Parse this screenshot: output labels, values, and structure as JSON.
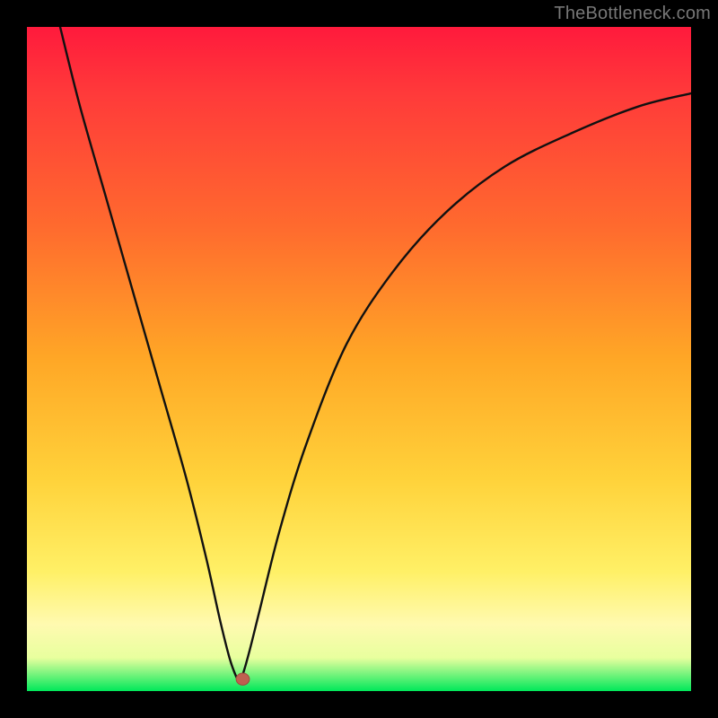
{
  "watermark": "TheBottleneck.com",
  "colors": {
    "curve_stroke": "#111111",
    "marker_fill": "#c06050",
    "marker_stroke": "#a04a3e"
  },
  "chart_data": {
    "type": "line",
    "title": "",
    "xlabel": "",
    "ylabel": "",
    "xlim": [
      0,
      100
    ],
    "ylim": [
      0,
      100
    ],
    "grid": false,
    "series": [
      {
        "name": "bottleneck-curve",
        "x": [
          5,
          8,
          12,
          16,
          20,
          24,
          27,
          29,
          30.5,
          31.5,
          32,
          32.5,
          33.5,
          35,
          38,
          42,
          48,
          55,
          63,
          72,
          82,
          92,
          100
        ],
        "y": [
          100,
          88,
          74,
          60,
          46,
          32,
          20,
          11,
          5,
          2.2,
          1.6,
          2.5,
          6,
          12,
          24,
          37,
          52,
          63,
          72,
          79,
          84,
          88,
          90
        ]
      }
    ],
    "marker": {
      "x": 32.5,
      "y": 1.8,
      "rx": 1.0,
      "ry": 0.9
    }
  }
}
